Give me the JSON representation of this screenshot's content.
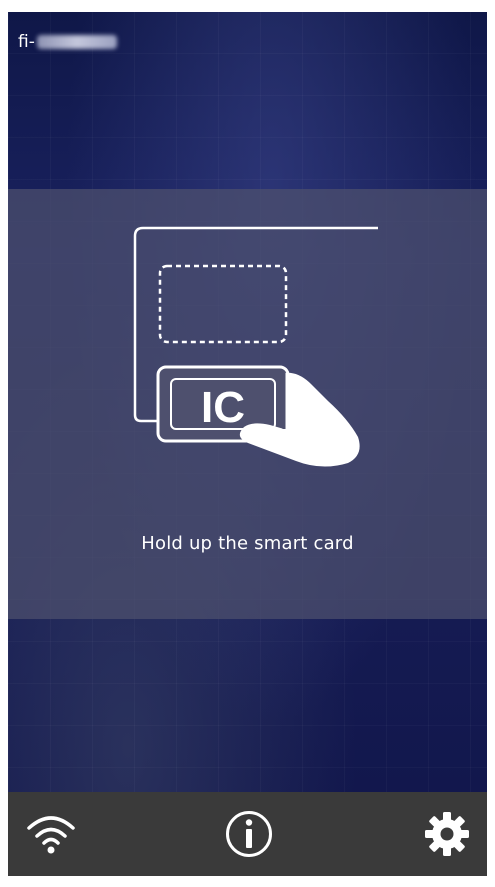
{
  "device": {
    "model_prefix": "fi-"
  },
  "prompt": {
    "message": "Hold up the smart card",
    "card_label": "IC"
  },
  "toolbar": {
    "buttons": [
      {
        "name": "wifi",
        "icon": "wifi-icon"
      },
      {
        "name": "info",
        "icon": "info-icon"
      },
      {
        "name": "settings",
        "icon": "gear-icon"
      }
    ]
  },
  "colors": {
    "panel_overlay": "#4e506e",
    "toolbar_bg": "#3a3a3a",
    "icon": "#ffffff"
  }
}
